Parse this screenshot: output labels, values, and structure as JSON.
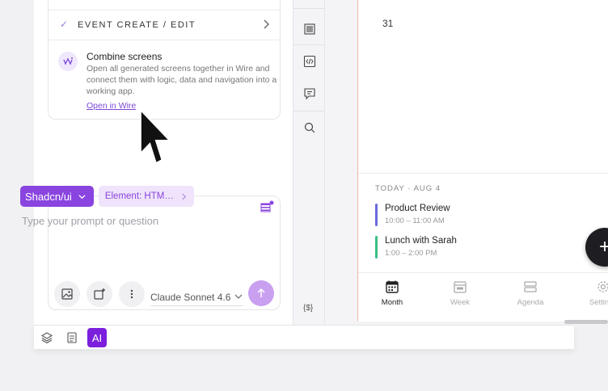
{
  "steps": {
    "event_step_label": "EVENT CREATE / EDIT",
    "check_glyph": "✓"
  },
  "combine": {
    "title": "Combine screens",
    "description": "Open all generated screens together in Wire and connect them with logic, data and navigation into a working app.",
    "link_label": "Open in Wire",
    "icon": "wire-icon"
  },
  "prompt": {
    "framework_label": "Shadcn/ui",
    "element_label": "Element: HTM…",
    "placeholder": "Type your prompt or question",
    "model_label": "Claude Sonnet 4.6",
    "tools": [
      "image-icon",
      "add-frame-icon",
      "more-icon"
    ],
    "send_icon": "arrow-up-icon"
  },
  "bottom_toolbar": {
    "ai_label": "AI",
    "buttons": [
      "layers-icon",
      "component-icon",
      "ai-button"
    ]
  },
  "rail": {
    "variables_label": "{$}",
    "icons": [
      "barcode-icon",
      "code-icon",
      "comment-icon",
      "search-icon"
    ]
  },
  "calendar": {
    "day_number": "31",
    "today_label": "TODAY · AUG 4",
    "events": [
      {
        "title": "Product Review",
        "time": "10:00 – 11:00 AM",
        "color": "#6b6bdc"
      },
      {
        "title": "Lunch with Sarah",
        "time": "1:00 – 2:00 PM",
        "color": "#3bbf86"
      }
    ],
    "tabs": [
      {
        "label": "Month",
        "icon": "calendar-icon",
        "active": true
      },
      {
        "label": "Week",
        "icon": "week-icon",
        "active": false
      },
      {
        "label": "Agenda",
        "icon": "agenda-icon",
        "active": false
      },
      {
        "label": "Settings",
        "icon": "gear-icon",
        "active": false
      }
    ],
    "fab_glyph": "+"
  },
  "colors": {
    "accent": "#8a44df",
    "ai_button": "#7b1fdc",
    "send_button": "#c9a0f0",
    "screen_border": "#f0b8a8"
  }
}
